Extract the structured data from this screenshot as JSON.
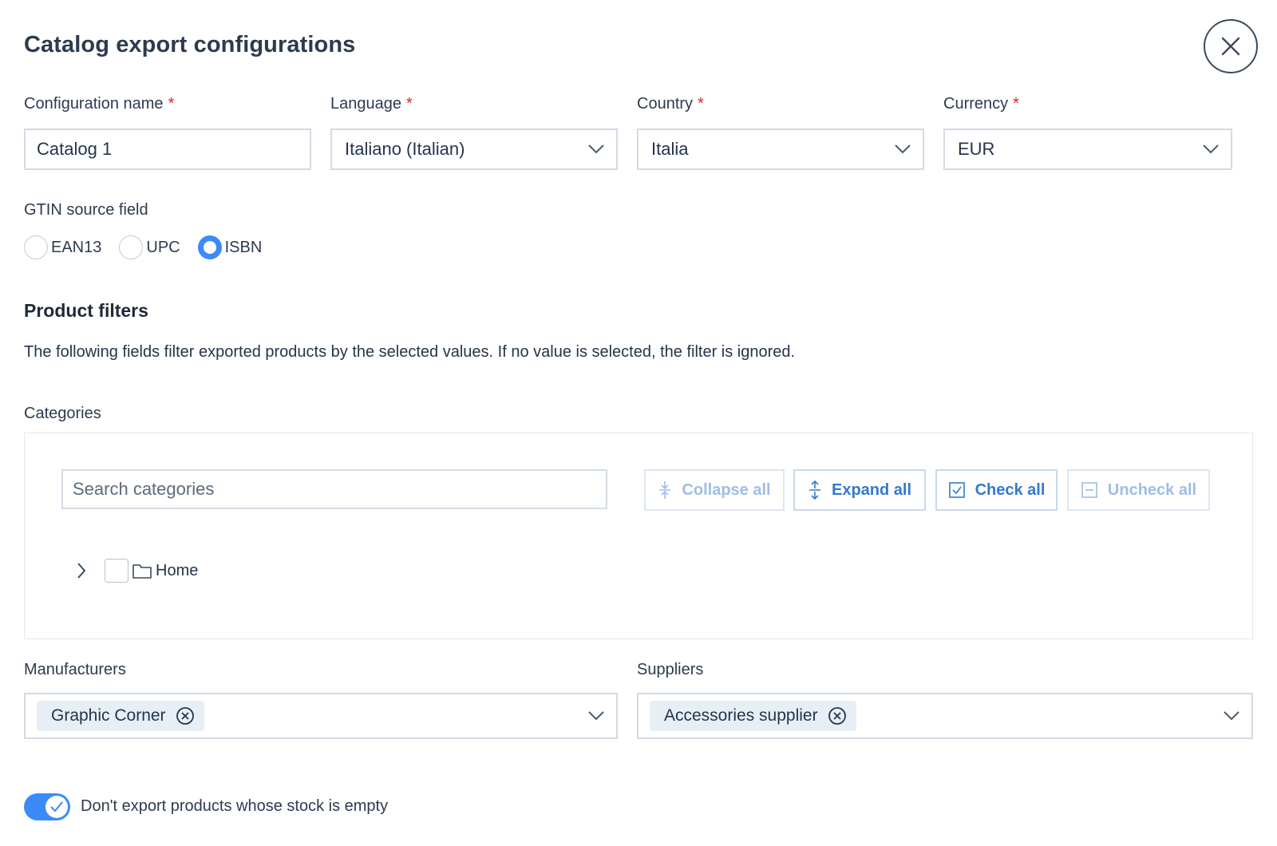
{
  "modal": {
    "title": "Catalog export configurations",
    "close_icon": "close-icon"
  },
  "form": {
    "config_name": {
      "label": "Configuration name",
      "required_mark": "*",
      "value": "Catalog 1"
    },
    "language": {
      "label": "Language",
      "required_mark": "*",
      "value": "Italiano (Italian)"
    },
    "country": {
      "label": "Country",
      "required_mark": "*",
      "value": "Italia"
    },
    "currency": {
      "label": "Currency",
      "required_mark": "*",
      "value": "EUR"
    },
    "gtin": {
      "label": "GTIN source field",
      "options": [
        "EAN13",
        "UPC",
        "ISBN"
      ],
      "selected": "ISBN"
    }
  },
  "filters": {
    "title": "Product filters",
    "description": "The following fields filter exported products by the selected values. If no value is selected, the filter is ignored.",
    "categories": {
      "label": "Categories",
      "search_placeholder": "Search categories",
      "buttons": {
        "collapse_all": "Collapse all",
        "expand_all": "Expand all",
        "check_all": "Check all",
        "uncheck_all": "Uncheck all"
      },
      "tree": [
        {
          "label": "Home",
          "checked": false,
          "expanded": false
        }
      ]
    },
    "manufacturers": {
      "label": "Manufacturers",
      "selected": [
        "Graphic Corner"
      ]
    },
    "suppliers": {
      "label": "Suppliers",
      "selected": [
        "Accessories supplier"
      ]
    }
  },
  "stock_toggle": {
    "label": "Don't export products whose stock is empty",
    "checked": true
  },
  "colors": {
    "accent": "#3c8af7",
    "required": "#e02020",
    "button_text": "#3379cf"
  },
  "icons": [
    "close-icon",
    "chevron-down-icon",
    "chevron-right-icon",
    "folder-icon",
    "collapse-icon",
    "expand-icon",
    "check-square-icon",
    "minus-square-icon",
    "remove-circle-icon",
    "check-icon"
  ]
}
